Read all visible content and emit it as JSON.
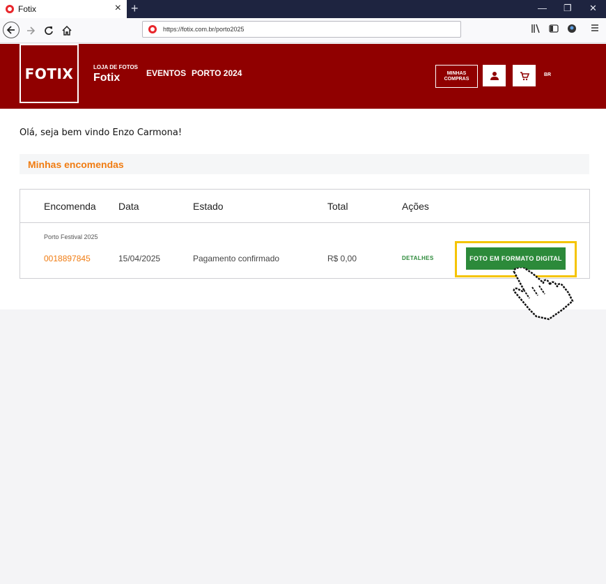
{
  "browser": {
    "tab_title": "Fotix",
    "tab_close": "×",
    "new_tab": "+",
    "url": "https://fotix.com.br/porto2025",
    "window_controls": {
      "minimize": "—",
      "restore": "❐",
      "close": "✕"
    }
  },
  "header": {
    "logo": "FOTIX",
    "store_subtitle": "LOJA DE FOTOS",
    "store_name": "Fotix",
    "nav": [
      "EVENTOS",
      "PORTO 2024"
    ],
    "my_purchases_line1": "MINHAS",
    "my_purchases_line2": "COMPRAS",
    "lang": "BR"
  },
  "main": {
    "welcome": "Olá, seja bem vindo Enzo Carmona!",
    "section_title": "Minhas encomendas",
    "table": {
      "headers": [
        "Encomenda",
        "Data",
        "Estado",
        "Total",
        "Ações"
      ],
      "event_name": "Porto Festival 2025",
      "row": {
        "order": "0018897845",
        "date": "15/04/2025",
        "status": "Pagamento confirmado",
        "total": "R$ 0,00",
        "details": "DETALHES",
        "digital_button": "FOTO EM FORMATO DIGITAL"
      }
    }
  },
  "colors": {
    "brand_red": "#900000",
    "accent_orange": "#f07c12",
    "action_green": "#2c8a3a",
    "highlight_yellow": "#f5c400"
  }
}
